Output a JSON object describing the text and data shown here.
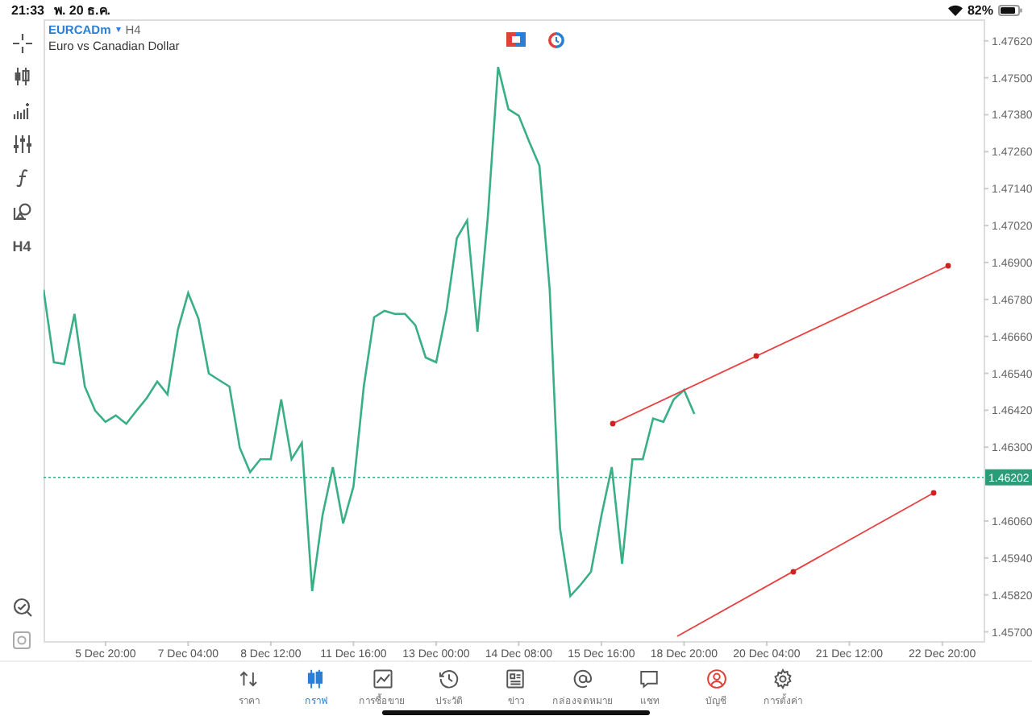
{
  "status_bar": {
    "time": "21:33",
    "date": "พ. 20 ธ.ค.",
    "battery": "82%"
  },
  "symbol": {
    "name": "EURCADm",
    "marker": "▾",
    "timeframe": "H4",
    "description": "Euro vs Canadian Dollar"
  },
  "left_toolbar": {
    "timeframe": "H4"
  },
  "chart_data": {
    "type": "line",
    "ylim": [
      1.4567,
      1.4769
    ],
    "categories": [
      null,
      null,
      null,
      null,
      null,
      null,
      "5 Dec 20:00",
      null,
      null,
      null,
      null,
      null,
      null,
      null,
      "7 Dec 04:00",
      null,
      null,
      null,
      null,
      null,
      null,
      null,
      "8 Dec 12:00",
      null,
      null,
      null,
      null,
      null,
      null,
      null,
      "11 Dec 16:00",
      null,
      null,
      null,
      null,
      null,
      null,
      null,
      "13 Dec 00:00",
      null,
      null,
      null,
      null,
      null,
      null,
      null,
      "14 Dec 08:00",
      null,
      null,
      null,
      null,
      null,
      null,
      null,
      "15 Dec 16:00",
      null,
      null,
      null,
      null,
      null,
      null,
      null,
      "18 Dec 20:00",
      null,
      null,
      null,
      null,
      null,
      null,
      null,
      "20 Dec 04:00",
      null,
      null,
      null,
      null,
      null,
      null,
      null,
      "21 Dec 12:00",
      null,
      null,
      null,
      null,
      null,
      null,
      null,
      null,
      "22 Dec 20:00",
      null,
      null,
      null
    ],
    "yticks": [
      {
        "value": 1.4762,
        "label": "1.47620"
      },
      {
        "value": 1.475,
        "label": "1.47500"
      },
      {
        "value": 1.4738,
        "label": "1.47380"
      },
      {
        "value": 1.4726,
        "label": "1.47260"
      },
      {
        "value": 1.4714,
        "label": "1.47140"
      },
      {
        "value": 1.4702,
        "label": "1.47020"
      },
      {
        "value": 1.469,
        "label": "1.46900"
      },
      {
        "value": 1.4678,
        "label": "1.46780"
      },
      {
        "value": 1.4666,
        "label": "1.46660"
      },
      {
        "value": 1.4654,
        "label": "1.46540"
      },
      {
        "value": 1.4642,
        "label": "1.46420"
      },
      {
        "value": 1.463,
        "label": "1.46300"
      },
      {
        "value": 1.4606,
        "label": "1.46060"
      },
      {
        "value": 1.4594,
        "label": "1.45940"
      },
      {
        "value": 1.4582,
        "label": "1.45820"
      },
      {
        "value": 1.457,
        "label": "1.45700"
      }
    ],
    "series": [
      {
        "color": "#3aaf85",
        "values": [
          1.46812,
          1.46576,
          1.4657,
          1.46733,
          1.46497,
          1.46419,
          1.46382,
          1.46403,
          1.46376,
          1.46419,
          1.4646,
          1.46513,
          1.46471,
          1.46681,
          1.46801,
          1.46717,
          1.46539,
          1.46518,
          1.46497,
          1.46298,
          1.46219,
          1.46261,
          1.46261,
          1.46455,
          1.46261,
          1.46314,
          1.45832,
          1.46078,
          1.46235,
          1.46052,
          1.46172,
          1.46497,
          1.46722,
          1.46743,
          1.46733,
          1.46733,
          1.46696,
          1.46591,
          1.46576,
          1.46743,
          1.46979,
          1.47037,
          1.46675,
          1.47047,
          1.47535,
          1.47398,
          1.47377,
          1.47294,
          1.47215,
          1.46812,
          1.46036,
          1.45816,
          1.45853,
          1.45895,
          1.46078,
          1.46235,
          1.45921,
          1.46261,
          1.46261,
          1.46393,
          1.46382,
          1.46455,
          1.46486,
          1.46408,
          null,
          null,
          null,
          null,
          null,
          null,
          null,
          null,
          null,
          null,
          null,
          null,
          null,
          null,
          null,
          null,
          null,
          null,
          null,
          null,
          null,
          null,
          null,
          null,
          null,
          null,
          null
        ]
      }
    ]
  },
  "current_price": {
    "label": "1.46202"
  },
  "tabs": [
    {
      "label": "ราคา",
      "selected": false,
      "attention": false
    },
    {
      "label": "กราฟ",
      "selected": true,
      "attention": false
    },
    {
      "label": "การซื้อขาย",
      "selected": false,
      "attention": false
    },
    {
      "label": "ประวัติ",
      "selected": false,
      "attention": false
    },
    {
      "label": "ข่าว",
      "selected": false,
      "attention": false
    },
    {
      "label": "กล่องจดหมาย",
      "selected": false,
      "attention": false
    },
    {
      "label": "แชท",
      "selected": false,
      "attention": false
    },
    {
      "label": "บัญชี",
      "selected": false,
      "attention": true
    },
    {
      "label": "การตั้งค่า",
      "selected": false,
      "attention": false
    }
  ]
}
